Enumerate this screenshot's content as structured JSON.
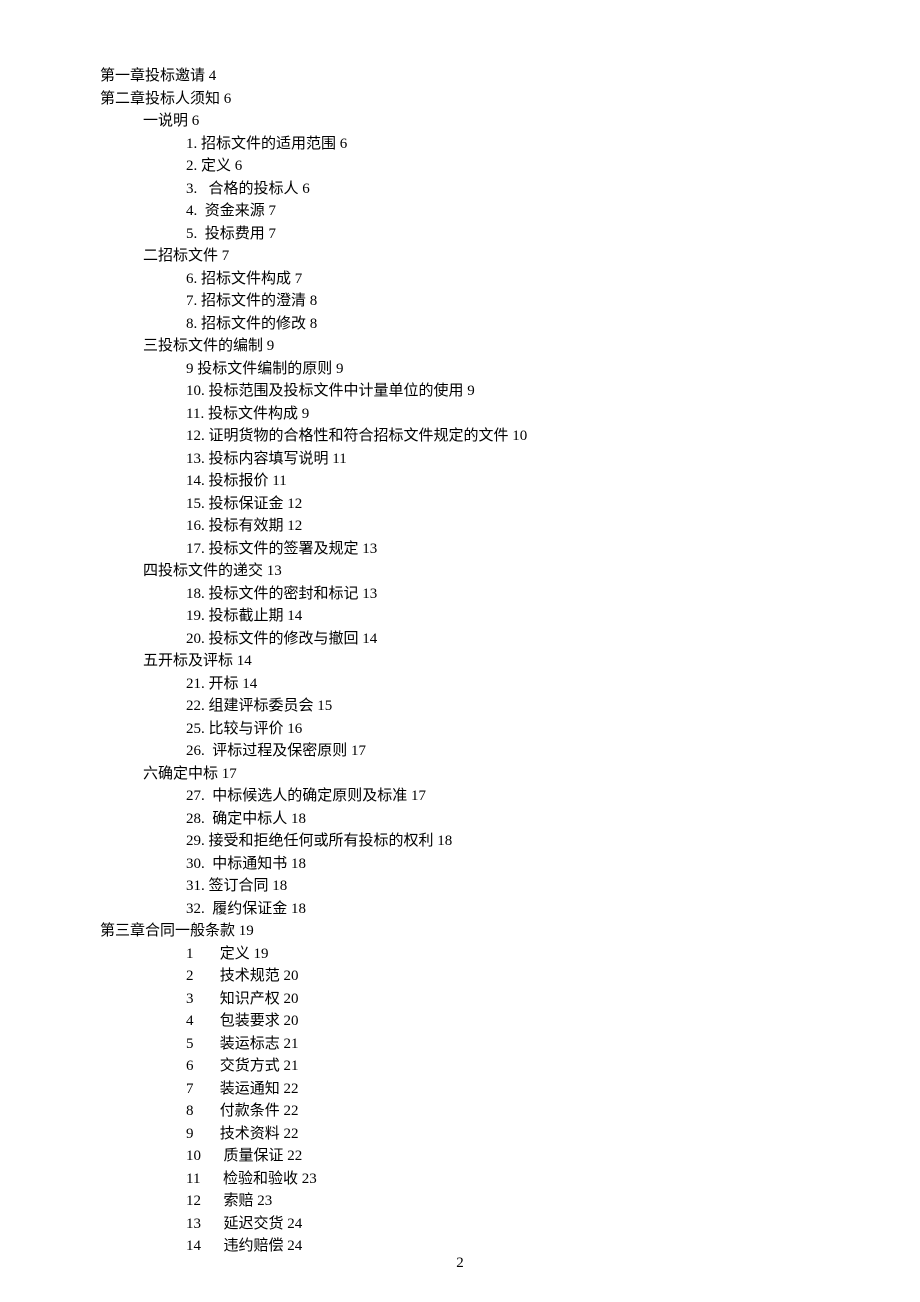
{
  "toc": [
    {
      "indent": 0,
      "text": "第一章投标邀请 4"
    },
    {
      "indent": 0,
      "text": "第二章投标人须知 6"
    },
    {
      "indent": 1,
      "text": "一说明 6"
    },
    {
      "indent": 2,
      "text": "1. 招标文件的适用范围 6"
    },
    {
      "indent": 2,
      "text": "2. 定义 6"
    },
    {
      "indent": 2,
      "text": "3.   合格的投标人 6"
    },
    {
      "indent": 2,
      "text": "4.  资金来源 7"
    },
    {
      "indent": 2,
      "text": "5.  投标费用 7"
    },
    {
      "indent": 1,
      "text": "二招标文件 7"
    },
    {
      "indent": 2,
      "text": "6. 招标文件构成 7"
    },
    {
      "indent": 2,
      "text": "7. 招标文件的澄清 8"
    },
    {
      "indent": 2,
      "text": "8. 招标文件的修改 8"
    },
    {
      "indent": 1,
      "text": "三投标文件的编制 9"
    },
    {
      "indent": 2,
      "text": "9 投标文件编制的原则 9"
    },
    {
      "indent": 2,
      "text": "10. 投标范围及投标文件中计量单位的使用 9"
    },
    {
      "indent": 2,
      "text": "11. 投标文件构成 9"
    },
    {
      "indent": 2,
      "text": "12. 证明货物的合格性和符合招标文件规定的文件 10"
    },
    {
      "indent": 2,
      "text": "13. 投标内容填写说明 11"
    },
    {
      "indent": 2,
      "text": "14. 投标报价 11"
    },
    {
      "indent": 2,
      "text": "15. 投标保证金 12"
    },
    {
      "indent": 2,
      "text": "16. 投标有效期 12"
    },
    {
      "indent": 2,
      "text": "17. 投标文件的签署及规定 13"
    },
    {
      "indent": 1,
      "text": "四投标文件的递交 13"
    },
    {
      "indent": 2,
      "text": "18. 投标文件的密封和标记 13"
    },
    {
      "indent": 2,
      "text": "19. 投标截止期 14"
    },
    {
      "indent": 2,
      "text": "20. 投标文件的修改与撤回 14"
    },
    {
      "indent": 1,
      "text": "五开标及评标 14"
    },
    {
      "indent": 2,
      "text": "21. 开标 14"
    },
    {
      "indent": 2,
      "text": "22. 组建评标委员会 15"
    },
    {
      "indent": 2,
      "text": "25. 比较与评价 16"
    },
    {
      "indent": 2,
      "text": "26.  评标过程及保密原则 17"
    },
    {
      "indent": 1,
      "text": "六确定中标 17"
    },
    {
      "indent": 2,
      "text": "27.  中标候选人的确定原则及标准 17"
    },
    {
      "indent": 2,
      "text": "28.  确定中标人 18"
    },
    {
      "indent": 2,
      "text": "29. 接受和拒绝任何或所有投标的权利 18"
    },
    {
      "indent": 2,
      "text": "30.  中标通知书 18"
    },
    {
      "indent": 2,
      "text": "31. 签订合同 18"
    },
    {
      "indent": 2,
      "text": "32.  履约保证金 18"
    },
    {
      "indent": 0,
      "text": "第三章合同一般条款 19"
    },
    {
      "indent": 2,
      "text": "1       定义 19"
    },
    {
      "indent": 2,
      "text": "2       技术规范 20"
    },
    {
      "indent": 2,
      "text": "3       知识产权 20"
    },
    {
      "indent": 2,
      "text": "4       包装要求 20"
    },
    {
      "indent": 2,
      "text": "5       装运标志 21"
    },
    {
      "indent": 2,
      "text": "6       交货方式 21"
    },
    {
      "indent": 2,
      "text": "7       装运通知 22"
    },
    {
      "indent": 2,
      "text": "8       付款条件 22"
    },
    {
      "indent": 2,
      "text": "9       技术资料 22"
    },
    {
      "indent": 2,
      "text": "10      质量保证 22"
    },
    {
      "indent": 2,
      "text": "11      检验和验收 23"
    },
    {
      "indent": 2,
      "text": "12      索赔 23"
    },
    {
      "indent": 2,
      "text": "13      延迟交货 24"
    },
    {
      "indent": 2,
      "text": "14      违约赔偿 24"
    }
  ],
  "page_number": "2"
}
